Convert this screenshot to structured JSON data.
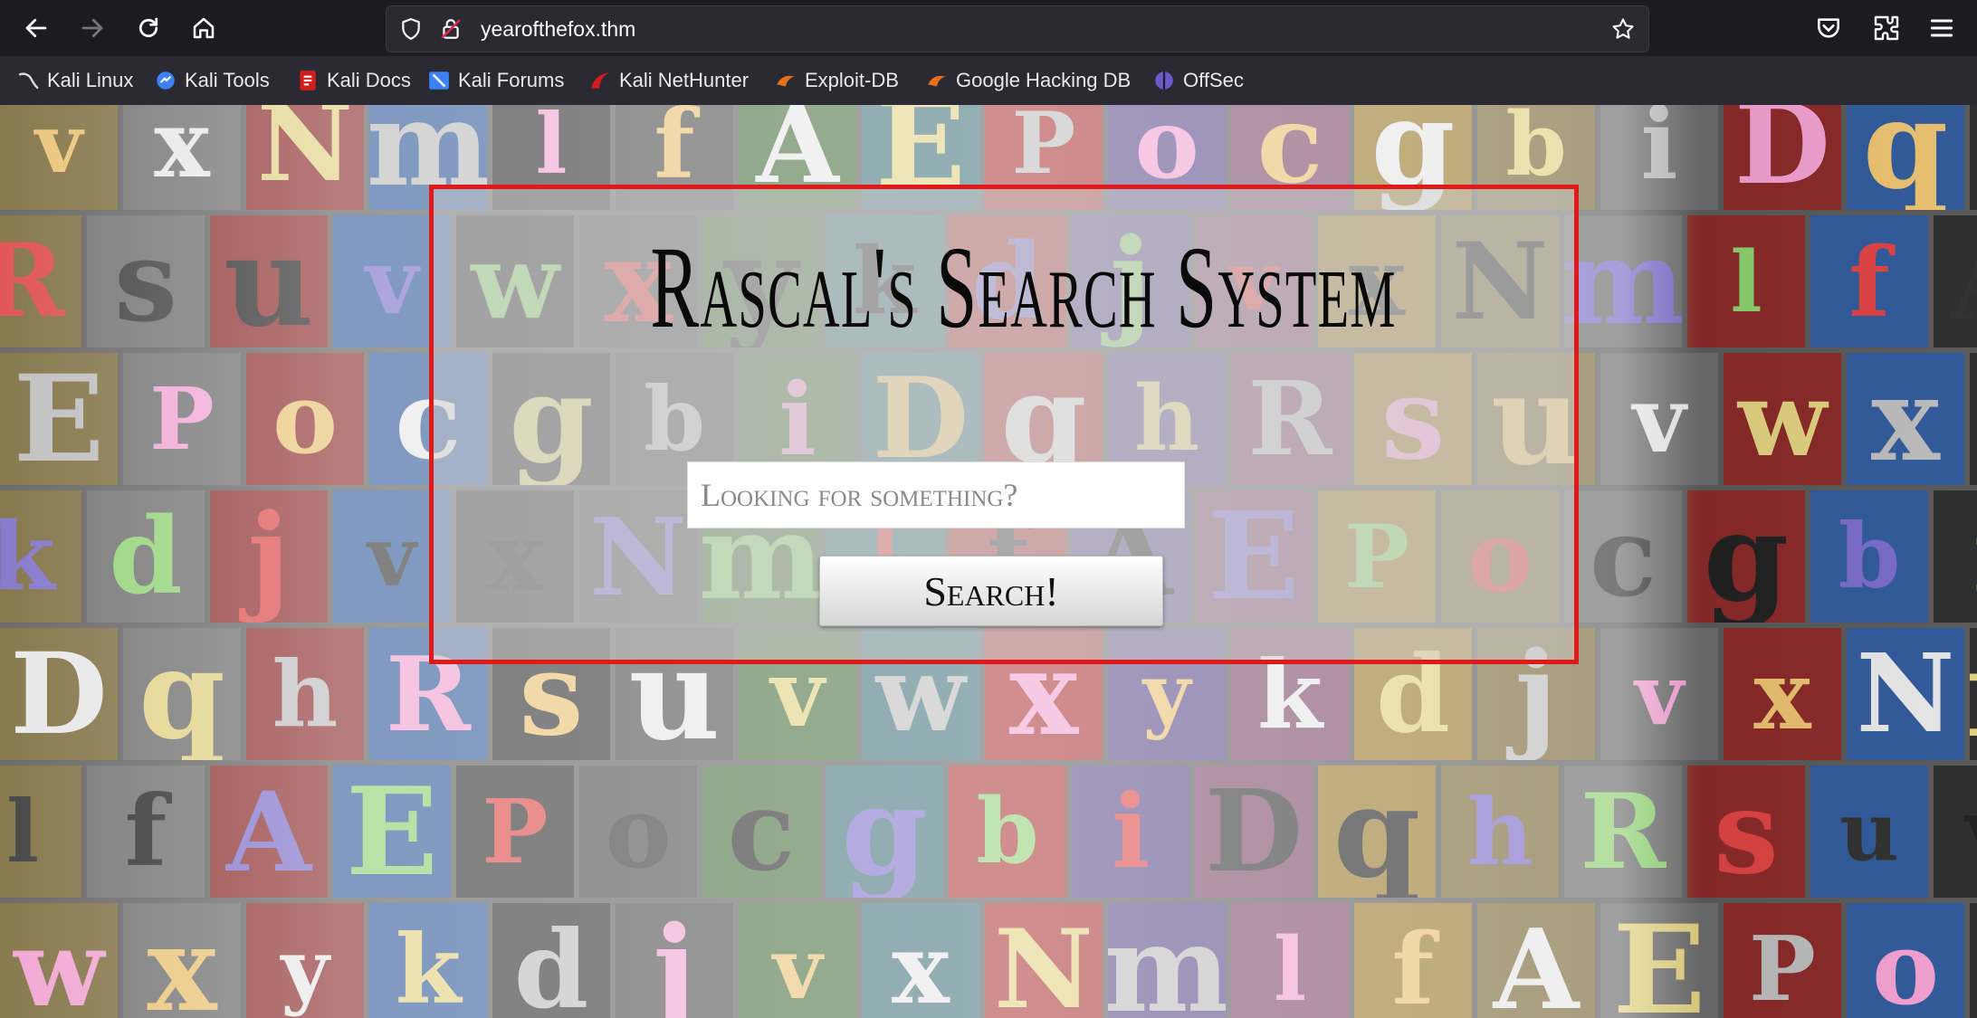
{
  "browser": {
    "url": "yearofthefox.thm",
    "bookmarks": [
      {
        "label": "Kali Linux",
        "color": "#cfcfcf"
      },
      {
        "label": "Kali Tools",
        "color": "#3b82f6"
      },
      {
        "label": "Kali Docs",
        "color": "#d11d1d"
      },
      {
        "label": "Kali Forums",
        "color": "#3b82f6"
      },
      {
        "label": "Kali NetHunter",
        "color": "#d11d1d"
      },
      {
        "label": "Exploit-DB",
        "color": "#e8701a"
      },
      {
        "label": "Google Hacking DB",
        "color": "#e8701a"
      },
      {
        "label": "OffSec",
        "color": "#6a5acd"
      }
    ]
  },
  "page": {
    "title": "Rascal's Search System",
    "search_placeholder": "Looking for something?",
    "search_button": "Search!",
    "accent": "#e01919"
  },
  "background_letters": [
    "v",
    "x",
    "N",
    "m",
    "l",
    "f",
    "A",
    "E",
    "P",
    "o",
    "c",
    "g",
    "b",
    "i",
    "D",
    "q",
    "h",
    "R",
    "s",
    "u",
    "v",
    "w",
    "x",
    "y",
    "k",
    "d",
    "j"
  ]
}
